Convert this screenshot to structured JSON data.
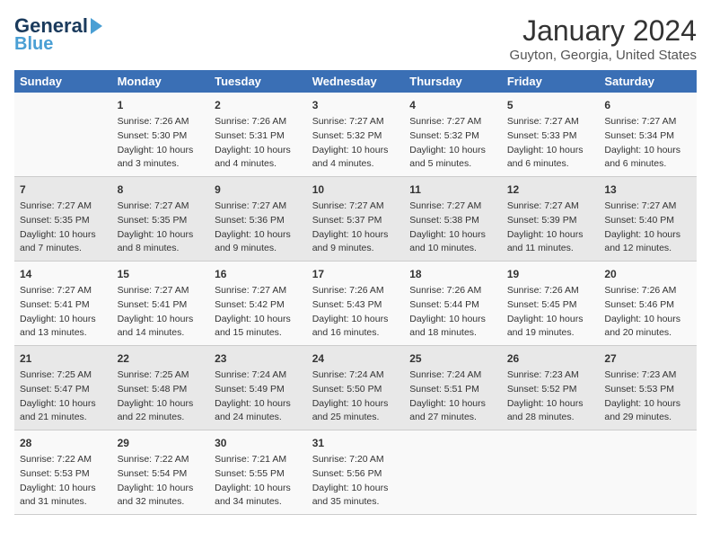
{
  "logo": {
    "general": "General",
    "blue": "Blue",
    "arrow": "▶"
  },
  "title": "January 2024",
  "subtitle": "Guyton, Georgia, United States",
  "columns": [
    "Sunday",
    "Monday",
    "Tuesday",
    "Wednesday",
    "Thursday",
    "Friday",
    "Saturday"
  ],
  "weeks": [
    [
      {
        "day": "",
        "info": ""
      },
      {
        "day": "1",
        "info": "Sunrise: 7:26 AM\nSunset: 5:30 PM\nDaylight: 10 hours\nand 3 minutes."
      },
      {
        "day": "2",
        "info": "Sunrise: 7:26 AM\nSunset: 5:31 PM\nDaylight: 10 hours\nand 4 minutes."
      },
      {
        "day": "3",
        "info": "Sunrise: 7:27 AM\nSunset: 5:32 PM\nDaylight: 10 hours\nand 4 minutes."
      },
      {
        "day": "4",
        "info": "Sunrise: 7:27 AM\nSunset: 5:32 PM\nDaylight: 10 hours\nand 5 minutes."
      },
      {
        "day": "5",
        "info": "Sunrise: 7:27 AM\nSunset: 5:33 PM\nDaylight: 10 hours\nand 6 minutes."
      },
      {
        "day": "6",
        "info": "Sunrise: 7:27 AM\nSunset: 5:34 PM\nDaylight: 10 hours\nand 6 minutes."
      }
    ],
    [
      {
        "day": "7",
        "info": "Sunrise: 7:27 AM\nSunset: 5:35 PM\nDaylight: 10 hours\nand 7 minutes."
      },
      {
        "day": "8",
        "info": "Sunrise: 7:27 AM\nSunset: 5:35 PM\nDaylight: 10 hours\nand 8 minutes."
      },
      {
        "day": "9",
        "info": "Sunrise: 7:27 AM\nSunset: 5:36 PM\nDaylight: 10 hours\nand 9 minutes."
      },
      {
        "day": "10",
        "info": "Sunrise: 7:27 AM\nSunset: 5:37 PM\nDaylight: 10 hours\nand 9 minutes."
      },
      {
        "day": "11",
        "info": "Sunrise: 7:27 AM\nSunset: 5:38 PM\nDaylight: 10 hours\nand 10 minutes."
      },
      {
        "day": "12",
        "info": "Sunrise: 7:27 AM\nSunset: 5:39 PM\nDaylight: 10 hours\nand 11 minutes."
      },
      {
        "day": "13",
        "info": "Sunrise: 7:27 AM\nSunset: 5:40 PM\nDaylight: 10 hours\nand 12 minutes."
      }
    ],
    [
      {
        "day": "14",
        "info": "Sunrise: 7:27 AM\nSunset: 5:41 PM\nDaylight: 10 hours\nand 13 minutes."
      },
      {
        "day": "15",
        "info": "Sunrise: 7:27 AM\nSunset: 5:41 PM\nDaylight: 10 hours\nand 14 minutes."
      },
      {
        "day": "16",
        "info": "Sunrise: 7:27 AM\nSunset: 5:42 PM\nDaylight: 10 hours\nand 15 minutes."
      },
      {
        "day": "17",
        "info": "Sunrise: 7:26 AM\nSunset: 5:43 PM\nDaylight: 10 hours\nand 16 minutes."
      },
      {
        "day": "18",
        "info": "Sunrise: 7:26 AM\nSunset: 5:44 PM\nDaylight: 10 hours\nand 18 minutes."
      },
      {
        "day": "19",
        "info": "Sunrise: 7:26 AM\nSunset: 5:45 PM\nDaylight: 10 hours\nand 19 minutes."
      },
      {
        "day": "20",
        "info": "Sunrise: 7:26 AM\nSunset: 5:46 PM\nDaylight: 10 hours\nand 20 minutes."
      }
    ],
    [
      {
        "day": "21",
        "info": "Sunrise: 7:25 AM\nSunset: 5:47 PM\nDaylight: 10 hours\nand 21 minutes."
      },
      {
        "day": "22",
        "info": "Sunrise: 7:25 AM\nSunset: 5:48 PM\nDaylight: 10 hours\nand 22 minutes."
      },
      {
        "day": "23",
        "info": "Sunrise: 7:24 AM\nSunset: 5:49 PM\nDaylight: 10 hours\nand 24 minutes."
      },
      {
        "day": "24",
        "info": "Sunrise: 7:24 AM\nSunset: 5:50 PM\nDaylight: 10 hours\nand 25 minutes."
      },
      {
        "day": "25",
        "info": "Sunrise: 7:24 AM\nSunset: 5:51 PM\nDaylight: 10 hours\nand 27 minutes."
      },
      {
        "day": "26",
        "info": "Sunrise: 7:23 AM\nSunset: 5:52 PM\nDaylight: 10 hours\nand 28 minutes."
      },
      {
        "day": "27",
        "info": "Sunrise: 7:23 AM\nSunset: 5:53 PM\nDaylight: 10 hours\nand 29 minutes."
      }
    ],
    [
      {
        "day": "28",
        "info": "Sunrise: 7:22 AM\nSunset: 5:53 PM\nDaylight: 10 hours\nand 31 minutes."
      },
      {
        "day": "29",
        "info": "Sunrise: 7:22 AM\nSunset: 5:54 PM\nDaylight: 10 hours\nand 32 minutes."
      },
      {
        "day": "30",
        "info": "Sunrise: 7:21 AM\nSunset: 5:55 PM\nDaylight: 10 hours\nand 34 minutes."
      },
      {
        "day": "31",
        "info": "Sunrise: 7:20 AM\nSunset: 5:56 PM\nDaylight: 10 hours\nand 35 minutes."
      },
      {
        "day": "",
        "info": ""
      },
      {
        "day": "",
        "info": ""
      },
      {
        "day": "",
        "info": ""
      }
    ]
  ]
}
